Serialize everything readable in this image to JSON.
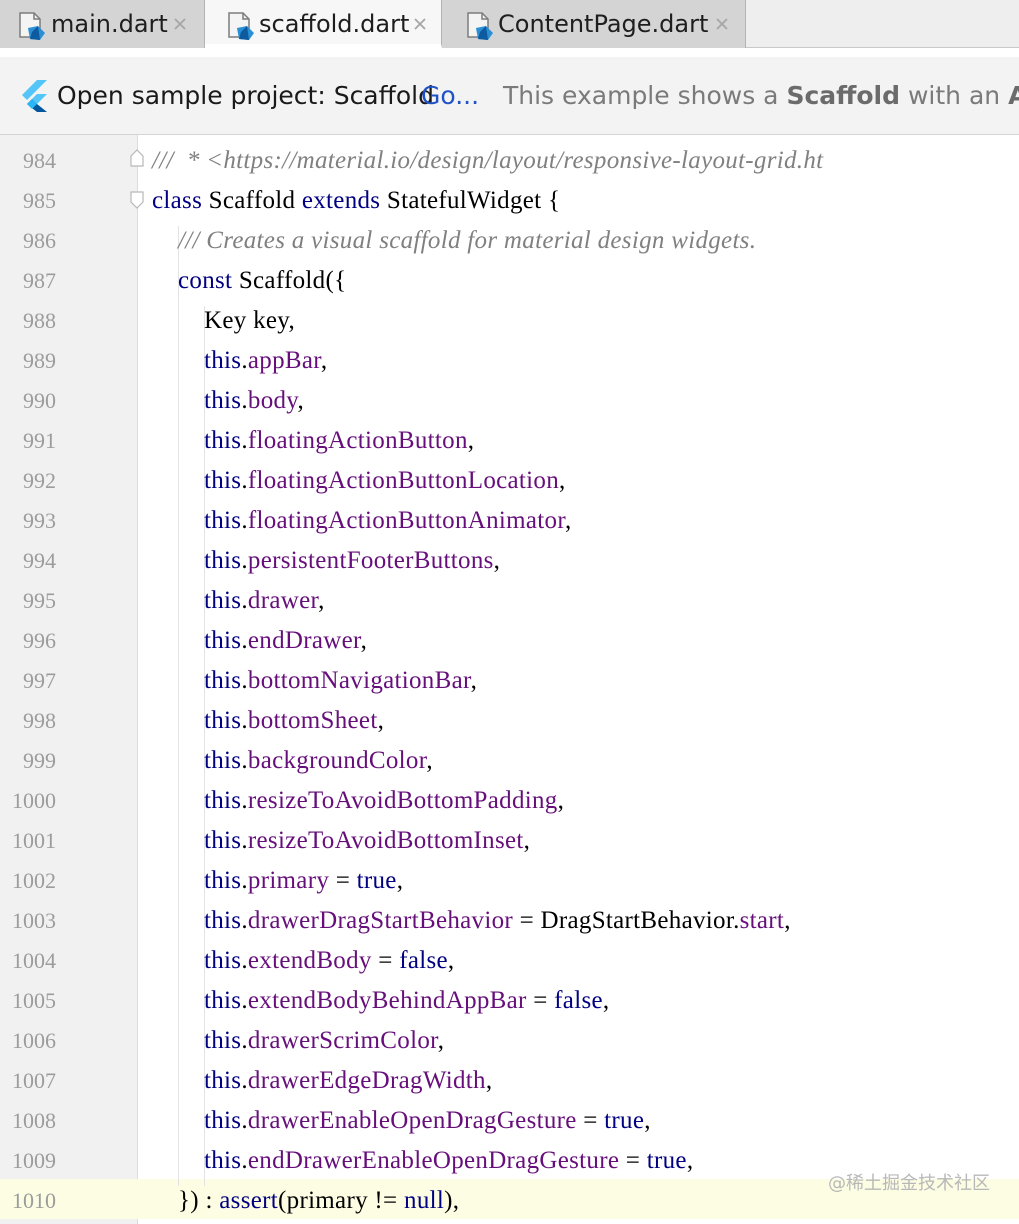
{
  "tabs": [
    {
      "label": "main.dart",
      "active": false,
      "icon": "dart-file-icon"
    },
    {
      "label": "scaffold.dart",
      "active": true,
      "icon": "dart-file-icon"
    },
    {
      "label": "ContentPage.dart",
      "active": false,
      "icon": "dart-file-icon"
    }
  ],
  "banner": {
    "icon": "flutter-logo-icon",
    "title": "Open sample project:  Scaffold",
    "link": "Go...",
    "desc_prefix": "This example shows a ",
    "desc_bold1": "Scaffold",
    "desc_mid": " with an ",
    "desc_bold2": "AppB"
  },
  "editor": {
    "current_line": "1010",
    "lines": [
      {
        "n": "984",
        "text": "///  * <https://material.io/design/layout/responsive-layout-grid.ht"
      },
      {
        "n": "985",
        "text": "class Scaffold extends StatefulWidget {"
      },
      {
        "n": "986",
        "text": "/// Creates a visual scaffold for material design widgets."
      },
      {
        "n": "987",
        "text": "const Scaffold({"
      },
      {
        "n": "988",
        "text": "Key key,"
      },
      {
        "n": "989",
        "text": "this.appBar,"
      },
      {
        "n": "990",
        "text": "this.body,"
      },
      {
        "n": "991",
        "text": "this.floatingActionButton,"
      },
      {
        "n": "992",
        "text": "this.floatingActionButtonLocation,"
      },
      {
        "n": "993",
        "text": "this.floatingActionButtonAnimator,"
      },
      {
        "n": "994",
        "text": "this.persistentFooterButtons,"
      },
      {
        "n": "995",
        "text": "this.drawer,"
      },
      {
        "n": "996",
        "text": "this.endDrawer,"
      },
      {
        "n": "997",
        "text": "this.bottomNavigationBar,"
      },
      {
        "n": "998",
        "text": "this.bottomSheet,"
      },
      {
        "n": "999",
        "text": "this.backgroundColor,"
      },
      {
        "n": "1000",
        "text": "this.resizeToAvoidBottomPadding,"
      },
      {
        "n": "1001",
        "text": "this.resizeToAvoidBottomInset,"
      },
      {
        "n": "1002",
        "text": "this.primary = true,"
      },
      {
        "n": "1003",
        "text": "this.drawerDragStartBehavior = DragStartBehavior.start,"
      },
      {
        "n": "1004",
        "text": "this.extendBody = false,"
      },
      {
        "n": "1005",
        "text": "this.extendBodyBehindAppBar = false,"
      },
      {
        "n": "1006",
        "text": "this.drawerScrimColor,"
      },
      {
        "n": "1007",
        "text": "this.drawerEdgeDragWidth,"
      },
      {
        "n": "1008",
        "text": "this.drawerEnableOpenDragGesture = true,"
      },
      {
        "n": "1009",
        "text": "this.endDrawerEnableOpenDragGesture = true,"
      },
      {
        "n": "1010",
        "text": "}) : assert(primary != null),"
      }
    ]
  },
  "watermark": "@稀土掘金技术社区",
  "colors": {
    "keyword": "#000080",
    "field": "#660e7a",
    "comment": "#808080",
    "line_number": "#9c9c9c",
    "link": "#1f52c7",
    "current_line_bg": "#fdfde3"
  }
}
